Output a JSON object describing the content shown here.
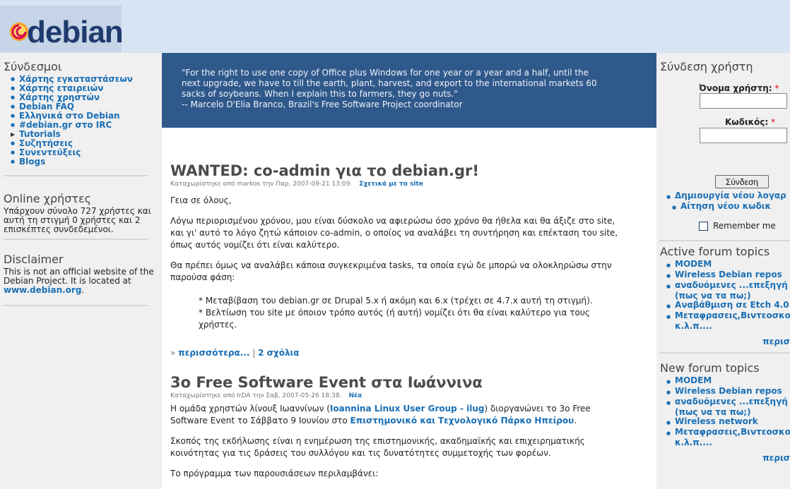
{
  "header": {
    "logo_text": "debian"
  },
  "left": {
    "links_title": "Σύνδεσμοι",
    "links": [
      {
        "label": "Χάρτης εγκαταστάσεων",
        "icon": "bullet-icon"
      },
      {
        "label": "Χάρτης εταιρειών",
        "icon": "bullet-icon"
      },
      {
        "label": "Χάρτης χρηστών",
        "icon": "bullet-icon"
      },
      {
        "label": "Debian FAQ",
        "icon": "bullet-icon"
      },
      {
        "label": "Ελληνικά στο Debian",
        "icon": "bullet-icon"
      },
      {
        "label": "#debian.gr στο IRC",
        "icon": "bullet-icon"
      },
      {
        "label": "Tutorials",
        "icon": "expand-triangle-icon"
      },
      {
        "label": "Συζητήσεις",
        "icon": "bullet-icon"
      },
      {
        "label": "Συνεντεύξεις",
        "icon": "bullet-icon"
      },
      {
        "label": "Blogs",
        "icon": "bullet-icon"
      }
    ],
    "online_title": "Online χρήστες",
    "online_text": "Υπάρχουν σύνολο 727 χρήστες και αυτή τη στιγμή 0 χρήστες και 2 επισκέπτες συνδεδεμένοι.",
    "disclaimer_title": "Disclaimer",
    "disclaimer_text": "This is not an official website of the Debian Project. It is located at",
    "disclaimer_link": "www.debian.org",
    "disclaimer_end": "."
  },
  "quote": {
    "line1": "\"For the right to use one copy of Office plus Windows for one year or a year and a half, until the",
    "line2": "next upgrade, we have to till the earth, plant, harvest, and export to the international markets 60",
    "line3": "sacks of soybeans. When I explain this to farmers, they go nuts.\"",
    "line4": "-- Marcelo D'Elia Branco, Brazil's Free Software Project coordinator"
  },
  "posts": [
    {
      "title": "WANTED: co-admin για το debian.gr!",
      "meta": "Καταχωρίστηκε από markos την Παρ, 2007-09-21 13:09.",
      "term": "Σχετικά με το site",
      "p1": "Γεια σε όλους,",
      "p2a": "Λόγω περιορισμένου χρόνου, μου είναι δύσκολο να αφιερώσω όσο χρόνο θα ήθελα και θα άξιζε στο site,",
      "p2b": "και γι' αυτό το λόγο ζητώ κάποιον co-admin, ο οποίος να αναλάβει τη συντήρηση και επέκταση του site,",
      "p2c": "όπως αυτός νομίζει ότι είναι καλύτερο.",
      "p3a": "Θα πρέπει όμως να αναλάβει κάποια συγκεκριμένα tasks, τα οποία εγώ δε μπορώ να ολοκληρώσω στην",
      "p3b": "παρούσα φάση:",
      "li1": "* Μεταβίβαση του debian.gr σε Drupal 5.x ή ακόμη και 6.x (τρέχει σε 4.7.x αυτή τη στιγμή).",
      "li2a": "* Βελτίωση του site με όποιον τρόπο αυτός (ή αυτή) νομίζει ότι θα είναι καλύτερο για τους",
      "li2b": "χρήστες.",
      "more_prefix": "»",
      "more": "περισσότερα...",
      "sep": "|",
      "comments": "2 σχόλια"
    },
    {
      "title": "3ο Free Software Event στα Ιωάννινα",
      "meta": "Καταχωρίστηκε από IrDA την Σαβ, 2007-05-26 18:38.",
      "term": "Νέα",
      "p1a": "Η ομάδα χρηστών λίνουξ Ιωαννίνων (",
      "p1link1": "Ioannina Linux User Group - ilug",
      "p1b": ") διοργανώνει το 3ο Free",
      "p1c": "Software Event το Σάββατο 9 Ιουνίου στο",
      "p1link2": "Επιστημονικό και Τεχνολογικό Πάρκο Ηπείρου",
      "p1d": ".",
      "p2a": "Σκοπός της εκδήλωσης είναι η ενημέρωση της επιστημονικής, ακαδημαϊκής και επιχειρηματικής",
      "p2b": "κοινότητας για τις δράσεις του συλλόγου και τις δυνατότητες συμμετοχής των φορέων.",
      "p3": "Το πρόγραμμα των παρουσιάσεων περιλαμβάνει:"
    }
  ],
  "right": {
    "login_title": "Σύνδεση χρήστη",
    "username_label": "Όνομα χρήστη:",
    "password_label": "Κωδικός:",
    "required_mark": "*",
    "login_button": "Σύνδεση",
    "create_account": "Δημιουργία νέου λογαρ",
    "request_password": "Αίτηση νέου κωδικ",
    "remember_me": "Remember me",
    "active_title": "Active forum topics",
    "active_topics": [
      "MODEM",
      "Wireless Debian repos",
      "αναδυόμενες ...επεξηγή",
      "(πως να τα πω;)",
      "Αναβάθμιση σε Etch 4.0",
      "Μεταφρασεις,Βιντεοσκο",
      "κ.λ.π...."
    ],
    "active_more": "περισ",
    "new_title": "New forum topics",
    "new_topics": [
      "MODEM",
      "Wireless Debian repos",
      "αναδυόμενες ...επεξηγή",
      "(πως να τα πω;)",
      "Wireless network",
      "Μεταφρασεις,Βιντεοσκο",
      "κ.λ.π...."
    ],
    "new_more": "περισ"
  },
  "colors": {
    "header_bg": "#d7e4f4",
    "quote_bg": "#30598b",
    "link": "#1a6fb5",
    "sidebar_bg": "#f0f0f0",
    "logo_red": "#d70a53"
  }
}
